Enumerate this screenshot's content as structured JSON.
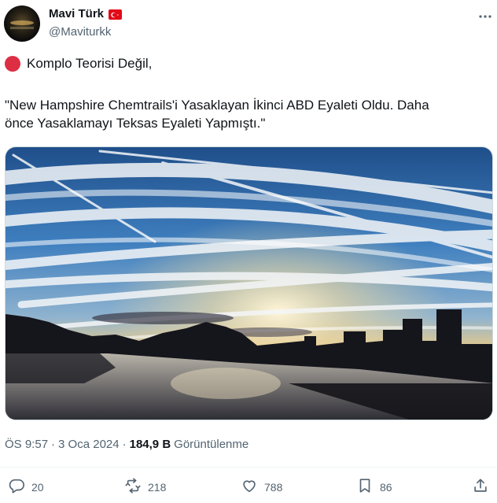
{
  "author": {
    "display_name": "Mavi Türk",
    "handle": "@Maviturkk",
    "flag_icon": "turkey-flag-icon"
  },
  "tweet": {
    "line1_icon": "red-circle-emoji",
    "line1": "Komplo Teorisi Değil,",
    "quote_line1": "\"New Hampshire Chemtrails'i Yasaklayan İkinci ABD Eyaleti Oldu. Daha",
    "quote_line2": "önce Yasaklamayı Teksas Eyaleti Yapmıştı.\""
  },
  "meta": {
    "time": "ÖS 9:57",
    "separator1": "·",
    "date": "3 Oca 2024",
    "separator2": "·",
    "views_count": "184,9 B",
    "views_label": "Görüntülenme"
  },
  "actions": {
    "replies": "20",
    "reposts": "218",
    "likes": "788",
    "bookmarks": "86"
  },
  "colors": {
    "text_primary": "#0f1419",
    "text_secondary": "#536471",
    "divider": "#eff3f4",
    "red_dot": "#dd2e44"
  }
}
